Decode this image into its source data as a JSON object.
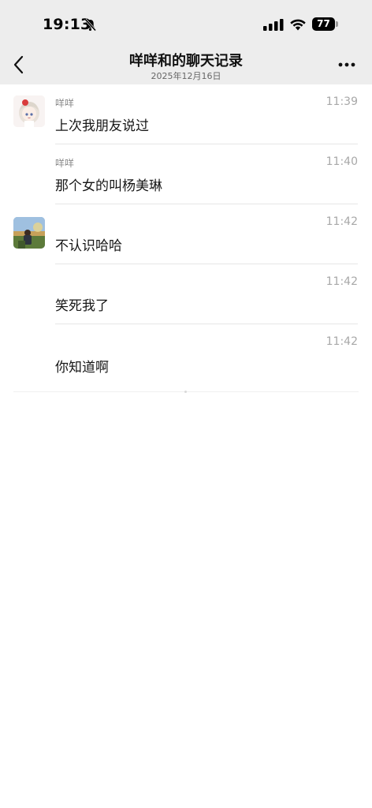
{
  "status_bar": {
    "time": "19:13",
    "battery": "77",
    "icons": [
      "bell-slash-icon",
      "signal-icon",
      "wifi-icon",
      "battery-icon"
    ]
  },
  "header": {
    "back_icon": "chevron-left-icon",
    "title": "咩咩和的聊天记录",
    "subtitle": "2025年12月16日",
    "more_icon": "more-dots-icon"
  },
  "messages": [
    {
      "sender": "咩咩",
      "time": "11:39",
      "text": "上次我朋友说过",
      "avatar": "anime-girl-avatar"
    },
    {
      "sender": "咩咩",
      "time": "11:40",
      "text": "那个女的叫杨美琳",
      "avatar": ""
    },
    {
      "sender": "",
      "time": "11:42",
      "text": "不认识哈哈",
      "avatar": "photo-avatar"
    },
    {
      "sender": "",
      "time": "11:42",
      "text": "笑死我了",
      "avatar": ""
    },
    {
      "sender": "",
      "time": "11:42",
      "text": "你知道啊",
      "avatar": ""
    }
  ],
  "colors": {
    "header_bg": "#ededed",
    "page_bg": "#ffffff",
    "secondary_text": "#8a8a8a",
    "time_text": "#a8a8a8",
    "divider": "#e6e6e6"
  }
}
